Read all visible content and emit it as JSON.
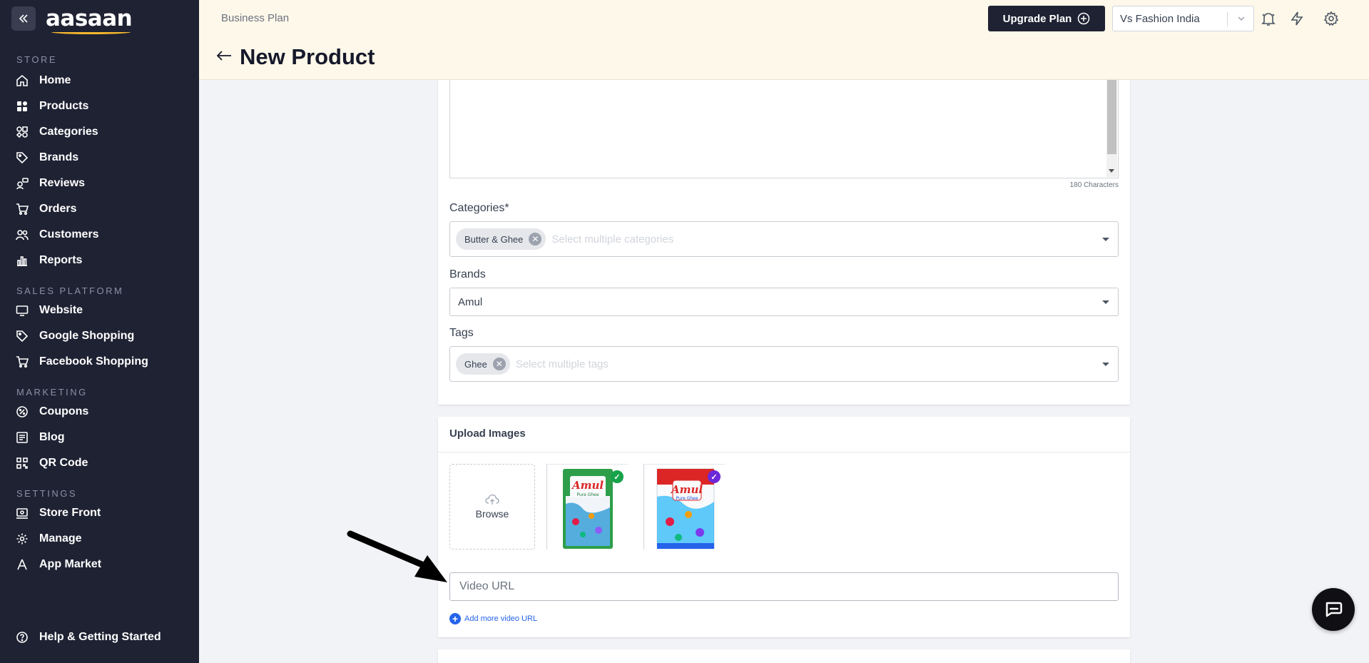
{
  "sidebar": {
    "logo_text": "aasaan",
    "sections": [
      {
        "title": "STORE",
        "items": [
          {
            "label": "Home",
            "icon": "home-icon"
          },
          {
            "label": "Products",
            "icon": "grid-icon"
          },
          {
            "label": "Categories",
            "icon": "categories-icon"
          },
          {
            "label": "Brands",
            "icon": "tag-icon"
          },
          {
            "label": "Reviews",
            "icon": "reviews-icon"
          },
          {
            "label": "Orders",
            "icon": "cart-icon"
          },
          {
            "label": "Customers",
            "icon": "users-icon"
          },
          {
            "label": "Reports",
            "icon": "bar-chart-icon"
          }
        ]
      },
      {
        "title": "SALES PLATFORM",
        "items": [
          {
            "label": "Website",
            "icon": "monitor-icon"
          },
          {
            "label": "Google Shopping",
            "icon": "tag-icon"
          },
          {
            "label": "Facebook Shopping",
            "icon": "cart-icon"
          }
        ]
      },
      {
        "title": "MARKETING",
        "items": [
          {
            "label": "Coupons",
            "icon": "coupon-icon"
          },
          {
            "label": "Blog",
            "icon": "blog-icon"
          },
          {
            "label": "QR Code",
            "icon": "qr-icon"
          }
        ]
      },
      {
        "title": "SETTINGS",
        "items": [
          {
            "label": "Store Front",
            "icon": "storefront-icon"
          },
          {
            "label": "Manage",
            "icon": "gear-icon"
          },
          {
            "label": "App Market",
            "icon": "app-market-icon"
          }
        ]
      }
    ],
    "help_label": "Help & Getting Started"
  },
  "header": {
    "plan_label": "Business Plan",
    "page_title": "New Product",
    "upgrade_label": "Upgrade Plan",
    "store_name": "Vs Fashion India"
  },
  "form": {
    "char_count": "180 Characters",
    "categories": {
      "label": "Categories",
      "required_mark": "*",
      "chips": [
        "Butter & Ghee"
      ],
      "placeholder": "Select multiple categories"
    },
    "brands": {
      "label": "Brands",
      "value": "Amul"
    },
    "tags": {
      "label": "Tags",
      "chips": [
        "Ghee"
      ],
      "placeholder": "Select multiple tags"
    }
  },
  "upload": {
    "title": "Upload Images",
    "browse_label": "Browse",
    "images": [
      {
        "brand": "Amul",
        "caption": "Pure Ghee",
        "badge_color": "#16a34a"
      },
      {
        "brand": "Amul",
        "caption": "Pure Ghee",
        "badge_color": "#6d28d9"
      }
    ],
    "video_placeholder": "Video URL",
    "add_video_label": "Add more video URL"
  },
  "colors": {
    "sidebar_bg": "#1f2233",
    "header_bg": "#fdf8e9",
    "accent_blue": "#2563eb"
  }
}
